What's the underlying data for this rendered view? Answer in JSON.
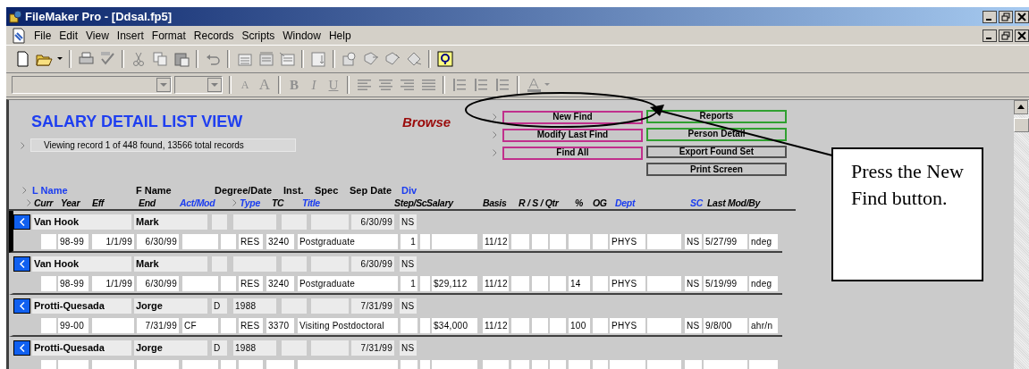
{
  "window": {
    "title": "FileMaker Pro - [Ddsal.fp5]"
  },
  "menu": [
    "File",
    "Edit",
    "View",
    "Insert",
    "Format",
    "Records",
    "Scripts",
    "Window",
    "Help"
  ],
  "style_buttons": [
    {
      "label": "A",
      "kind": "smaller",
      "disabled": true
    },
    {
      "label": "A",
      "kind": "larger",
      "disabled": true
    },
    {
      "label": "B",
      "kind": "bold",
      "disabled": true
    },
    {
      "label": "I",
      "kind": "italic",
      "disabled": true
    },
    {
      "label": "U",
      "kind": "underline",
      "disabled": true
    }
  ],
  "layout": {
    "title": "SALARY DETAIL LIST VIEW",
    "mode": "Browse",
    "status": "Viewing record 1 of 448 found, 13566 total records"
  },
  "find_buttons": [
    {
      "label": "New Find",
      "color": "#c0308c"
    },
    {
      "label": "Modify Last Find",
      "color": "#c0308c"
    },
    {
      "label": "Find All",
      "color": "#c0308c"
    }
  ],
  "action_buttons": [
    {
      "label": "Reports",
      "color": "#30a030"
    },
    {
      "label": "Person Detail",
      "color": "#30a030"
    },
    {
      "label": "Export Found Set",
      "color": "#505050"
    },
    {
      "label": "Print Screen",
      "color": "#505050"
    }
  ],
  "header_row_1": [
    {
      "label": "L Name",
      "color": "#1a3cf0",
      "chevron": true
    },
    {
      "label": "F Name",
      "color": "#000000",
      "chevron": false
    },
    {
      "label": "Degree/Date",
      "color": "#000000",
      "chevron": false
    },
    {
      "label": "Inst.",
      "color": "#000000",
      "chevron": false
    },
    {
      "label": "Spec",
      "color": "#000000",
      "chevron": false
    },
    {
      "label": "Sep Date",
      "color": "#000000",
      "chevron": false
    },
    {
      "label": "Div",
      "color": "#1a3cf0",
      "chevron": false
    }
  ],
  "header_row_2": [
    {
      "label": "Curr",
      "color": "#000000",
      "chevron": true
    },
    {
      "label": "Year",
      "color": "#000000",
      "chevron": false
    },
    {
      "label": "Eff",
      "color": "#000000",
      "chevron": false
    },
    {
      "label": "End",
      "color": "#000000",
      "chevron": false
    },
    {
      "label": "Act/Mod",
      "color": "#1a3cf0",
      "chevron": false
    },
    {
      "label": "Type",
      "color": "#1a3cf0",
      "chevron": true
    },
    {
      "label": "TC",
      "color": "#000000",
      "chevron": false
    },
    {
      "label": "Title",
      "color": "#1a3cf0",
      "chevron": false
    },
    {
      "label": "Step/Sc",
      "color": "#000000",
      "chevron": false
    },
    {
      "label": "Salary",
      "color": "#000000",
      "chevron": false
    },
    {
      "label": "Basis",
      "color": "#000000",
      "chevron": false
    },
    {
      "label": "R / S / Qtr",
      "color": "#000000",
      "chevron": false
    },
    {
      "label": "%",
      "color": "#000000",
      "chevron": false
    },
    {
      "label": "OG",
      "color": "#000000",
      "chevron": false
    },
    {
      "label": "Dept",
      "color": "#1a3cf0",
      "chevron": false
    },
    {
      "label": "SC",
      "color": "#1a3cf0",
      "chevron": false
    },
    {
      "label": "Last Mod/By",
      "color": "#000000",
      "chevron": false
    }
  ],
  "records": [
    {
      "selected": true,
      "top": {
        "last_name": "Van Hook",
        "first_name": "Mark",
        "sep_date": "6/30/99",
        "div": "NS"
      },
      "bottom": {
        "year": "98-99",
        "eff": "1/1/99",
        "end": "6/30/99",
        "type": "RES",
        "tc": "3240",
        "title": "Postgraduate",
        "step": "1",
        "basis": "11/12",
        "dept": "PHYS",
        "sc": "NS",
        "last_mod": "5/27/99",
        "by": "ndeg"
      }
    },
    {
      "selected": false,
      "top": {
        "last_name": "Van Hook",
        "first_name": "Mark",
        "sep_date": "6/30/99",
        "div": "NS"
      },
      "bottom": {
        "year": "98-99",
        "eff": "1/1/99",
        "end": "6/30/99",
        "type": "RES",
        "tc": "3240",
        "title": "Postgraduate",
        "step": "1",
        "salary": "$29,112",
        "basis": "11/12",
        "pct": "14",
        "dept": "PHYS",
        "sc": "NS",
        "last_mod": "5/19/99",
        "by": "ndeg"
      }
    },
    {
      "selected": false,
      "top": {
        "last_name": "Protti-Quesada",
        "first_name": "Jorge",
        "degree": "D",
        "degree_date": "1988",
        "sep_date": "7/31/99",
        "div": "NS"
      },
      "bottom": {
        "year": "99-00",
        "end": "7/31/99",
        "act_mod": "CF",
        "type": "RES",
        "tc": "3370",
        "title": "Visiting Postdoctoral",
        "salary": "$34,000",
        "basis": "11/12",
        "pct": "100",
        "dept": "PHYS",
        "sc": "NS",
        "last_mod": "9/8/00",
        "by": "ahr/n"
      }
    },
    {
      "selected": false,
      "top": {
        "last_name": "Protti-Quesada",
        "first_name": "Jorge",
        "degree": "D",
        "degree_date": "1988",
        "sep_date": "7/31/99",
        "div": "NS"
      }
    }
  ],
  "callout": {
    "text": "Press the New Find button."
  }
}
